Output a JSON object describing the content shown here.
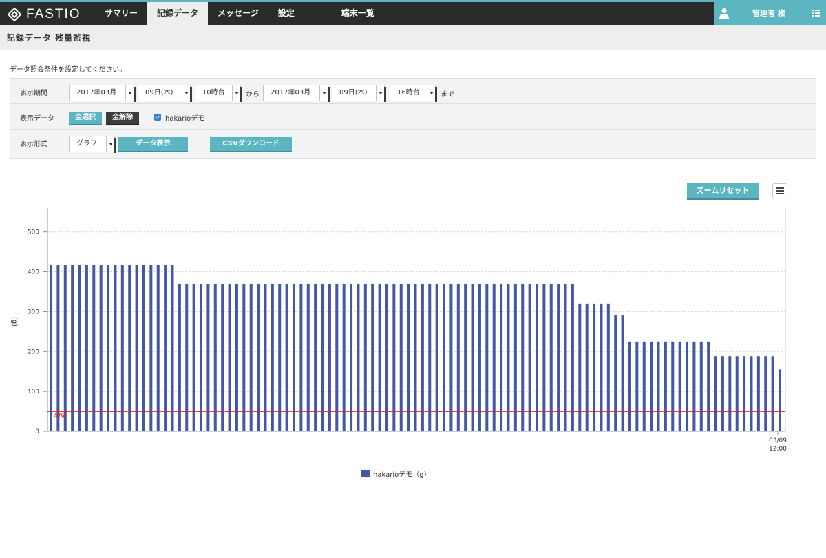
{
  "header": {
    "brand": "FASTIO",
    "nav": [
      "サマリー",
      "記録データ",
      "メッセージ",
      "設定",
      "端末一覧"
    ],
    "active_index": 1,
    "user_name": "管理者 様"
  },
  "page_title": "記録データ 残量監視",
  "instruction": "データ照会条件を設定してください。",
  "form": {
    "period_label": "表示期間",
    "from_month": "2017年03月",
    "from_day": "09日(木)",
    "from_hour": "10時台",
    "from_text": "から",
    "to_month": "2017年03月",
    "to_day": "09日(木)",
    "to_hour": "16時台",
    "to_text": "まで",
    "data_label": "表示データ",
    "select_all": "全選択",
    "clear_all": "全解除",
    "device_checkbox": "hakarioデモ",
    "format_label": "表示形式",
    "format_value": "グラフ",
    "show_button": "データ表示",
    "csv_button": "CSVダウンロード"
  },
  "chart_controls": {
    "zoom_reset": "ズームリセット",
    "menu_icon": "hamburger-icon"
  },
  "chart_data": {
    "type": "bar",
    "ylabel": "(g)",
    "yticks": [
      "0",
      "100",
      "200",
      "300",
      "400",
      "500"
    ],
    "ylim": [
      0,
      560
    ],
    "x_label_top": "03/09",
    "x_label_bottom": "12:00",
    "threshold": {
      "value": 50,
      "label": "閾値",
      "color": "#d62728"
    },
    "series": [
      {
        "name": "hakarioデモ（g）",
        "color": "#4457a1",
        "values": [
          418,
          418,
          418,
          418,
          418,
          418,
          418,
          418,
          418,
          418,
          418,
          418,
          418,
          418,
          418,
          418,
          418,
          418,
          370,
          370,
          370,
          370,
          370,
          370,
          370,
          370,
          370,
          370,
          370,
          370,
          370,
          370,
          370,
          370,
          370,
          370,
          370,
          370,
          370,
          370,
          370,
          370,
          370,
          370,
          370,
          370,
          370,
          370,
          370,
          370,
          370,
          370,
          370,
          370,
          370,
          370,
          370,
          370,
          370,
          370,
          370,
          370,
          370,
          370,
          370,
          370,
          370,
          370,
          370,
          370,
          370,
          370,
          370,
          370,
          320,
          320,
          320,
          320,
          320,
          292,
          292,
          225,
          225,
          225,
          225,
          225,
          225,
          225,
          225,
          225,
          225,
          225,
          225,
          188,
          188,
          188,
          188,
          188,
          188,
          188,
          188,
          188,
          155
        ]
      }
    ]
  }
}
